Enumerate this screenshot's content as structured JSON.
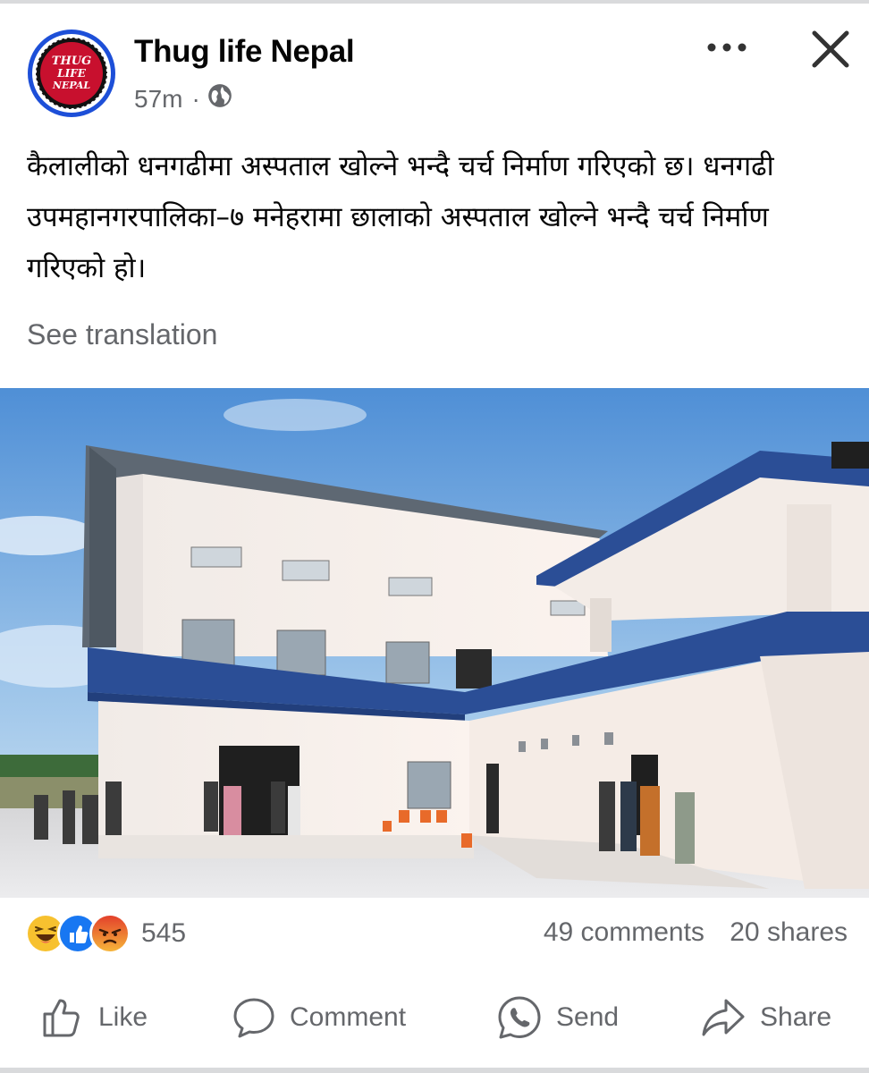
{
  "post": {
    "page_name": "Thug life Nepal",
    "time": "57m",
    "separator": "·",
    "audience_icon": "globe-icon",
    "avatar_text": [
      "THUG",
      "LIFE",
      "NEPAL"
    ],
    "text": "कैलालीको धनगढीमा अस्पताल खोल्ने भन्दै चर्च निर्माण गरिएको छ। धनगढी उपमहानगरपालिका–७ मनेहरामा छालाको अस्पताल खोल्ने भन्दै चर्च निर्माण गरिएको हो।",
    "see_translation": "See translation"
  },
  "reactions": {
    "icons": [
      "haha-icon",
      "like-icon",
      "angry-icon"
    ],
    "count": "545"
  },
  "stats": {
    "comments": "49 comments",
    "shares": "20 shares"
  },
  "actions": [
    {
      "label": "Like",
      "icon": "thumbs-up-icon"
    },
    {
      "label": "Comment",
      "icon": "comment-icon"
    },
    {
      "label": "Send",
      "icon": "whatsapp-icon"
    },
    {
      "label": "Share",
      "icon": "share-arrow-icon"
    }
  ],
  "colors": {
    "brand_red": "#c8102e",
    "avatar_ring": "#1d4fd8",
    "like_blue": "#1877f2",
    "secondary_text": "#65676b",
    "building_blue": "#2b4e96"
  }
}
